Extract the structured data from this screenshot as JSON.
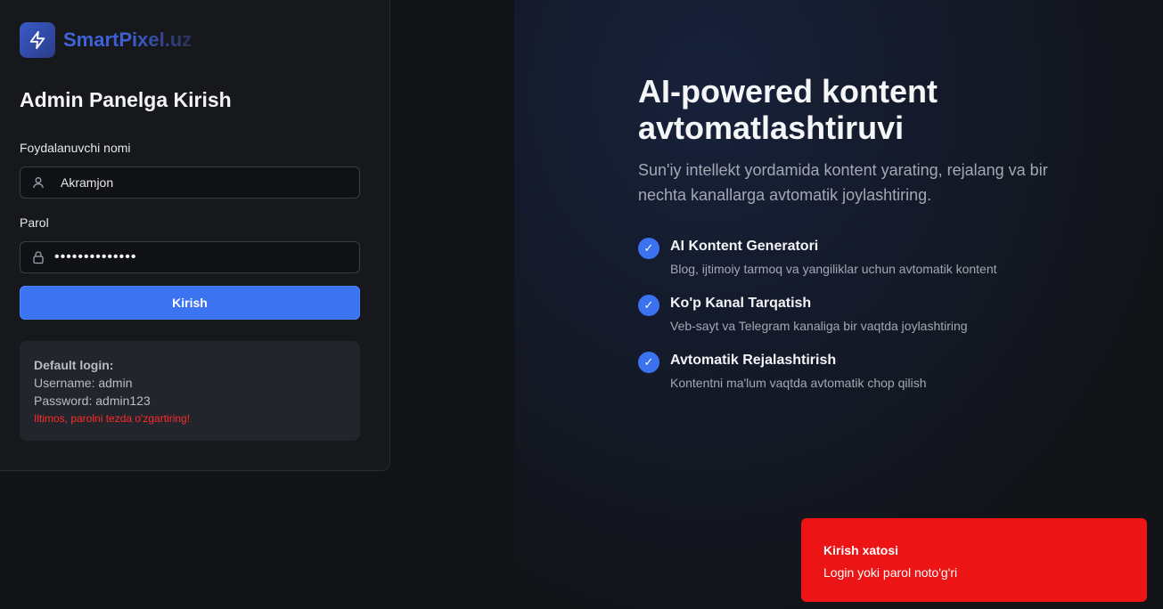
{
  "brand": {
    "name": "SmartPixel.uz",
    "logo_icon": "lightning-icon"
  },
  "login": {
    "title": "Admin Panelga Kirish",
    "username_label": "Foydalanuvchi nomi",
    "username_value": "Akramjon",
    "password_label": "Parol",
    "password_value": "••••••••••••••",
    "submit_label": "Kirish"
  },
  "hint": {
    "title": "Default login:",
    "username": "Username: admin",
    "password": "Password: admin123",
    "warning": "Iltimos, parolni tezda o'zgartiring!"
  },
  "hero": {
    "title": "AI-powered kontent avtomatlashtiruvi",
    "subtitle": "Sun'iy intellekt yordamida kontent yarating, rejalang va bir nechta kanallarga avtomatik joylashtiring.",
    "features": [
      {
        "title": "AI Kontent Generatori",
        "desc": "Blog, ijtimoiy tarmoq va yangiliklar uchun avtomatik kontent"
      },
      {
        "title": "Ko'p Kanal Tarqatish",
        "desc": "Veb-sayt va Telegram kanaliga bir vaqtda joylashtiring"
      },
      {
        "title": "Avtomatik Rejalashtirish",
        "desc": "Kontentni ma'lum vaqtda avtomatik chop qilish"
      }
    ],
    "check_glyph": "✓"
  },
  "toast": {
    "title": "Kirish xatosi",
    "message": "Login yoki parol noto'g'ri"
  },
  "colors": {
    "accent": "#3b73f0",
    "error": "#ec1414",
    "background": "#121317"
  }
}
